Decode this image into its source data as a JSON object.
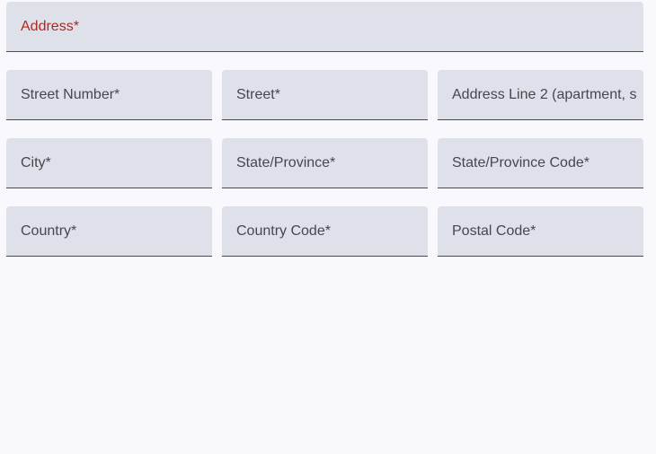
{
  "address": {
    "label": "Address*",
    "value": ""
  },
  "rows": [
    [
      {
        "label": "Street Number*",
        "value": ""
      },
      {
        "label": "Street*",
        "value": ""
      },
      {
        "label": "Address Line 2 (apartment, s",
        "value": ""
      }
    ],
    [
      {
        "label": "City*",
        "value": ""
      },
      {
        "label": "State/Province*",
        "value": ""
      },
      {
        "label": "State/Province Code*",
        "value": ""
      }
    ],
    [
      {
        "label": "Country*",
        "value": ""
      },
      {
        "label": "Country Code*",
        "value": ""
      },
      {
        "label": "Postal Code*",
        "value": ""
      }
    ]
  ],
  "colors": {
    "background": "#f9f8fd",
    "field_fill": "#dfe1ea",
    "error": "#b3261e",
    "label": "#46464f",
    "underline": "#4a4a55"
  }
}
